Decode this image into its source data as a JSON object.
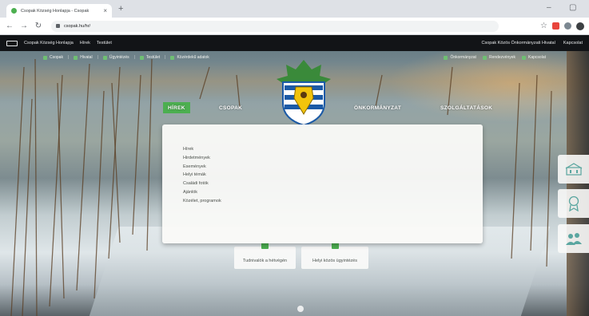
{
  "browser": {
    "tab_title": "Csopak Község Honlapja - Csopak",
    "tab_close": "×",
    "new_tab": "+",
    "minimize": "–",
    "maximize": "▢",
    "nav_back": "←",
    "nav_forward": "→",
    "reload": "↻",
    "url": "csopak.hu/hr/"
  },
  "site_bar": {
    "left_items": [
      "Csopak Község Honlapja",
      "Hírek",
      "Testület"
    ],
    "right_items": [
      "Csopak Közös Önkormányzati Hivatal",
      "Kapcsolat"
    ]
  },
  "quick_links": {
    "left": [
      "Csopak",
      "Hivatal",
      "Ügyintézés",
      "Testület",
      "Közérdekű adatok"
    ],
    "right": [
      "Önkormányzat",
      "Rendezvények",
      "Kapcsolat"
    ]
  },
  "main_nav": {
    "hirek": "HÍREK",
    "csopak": "CSOPAK",
    "onkormanyzat": "ÖNKORMÁNYZAT",
    "szolgaltatasok": "SZOLGÁLTATÁSOK"
  },
  "dropdown_items": [
    "Hírek",
    "Hirdetmények",
    "Események",
    "Helyi témák",
    "Családi fotók",
    "Ajánlók",
    "Közélet, programok"
  ],
  "quick_buttons": {
    "first": "Tudnivalók a hétvégén",
    "second": "Helyi közös ügyintézés"
  },
  "colors": {
    "accent_green": "#4caf50",
    "site_bar": "#121417",
    "dropdown_bg": "#fafaf8",
    "crest_blue": "#1b5aa6",
    "crest_yellow": "#f2c40c",
    "crest_leaf": "#3a8a3a"
  },
  "icons": {
    "side_button_1": "building-icon",
    "side_button_2": "award-icon",
    "side_button_3": "people-icon"
  }
}
